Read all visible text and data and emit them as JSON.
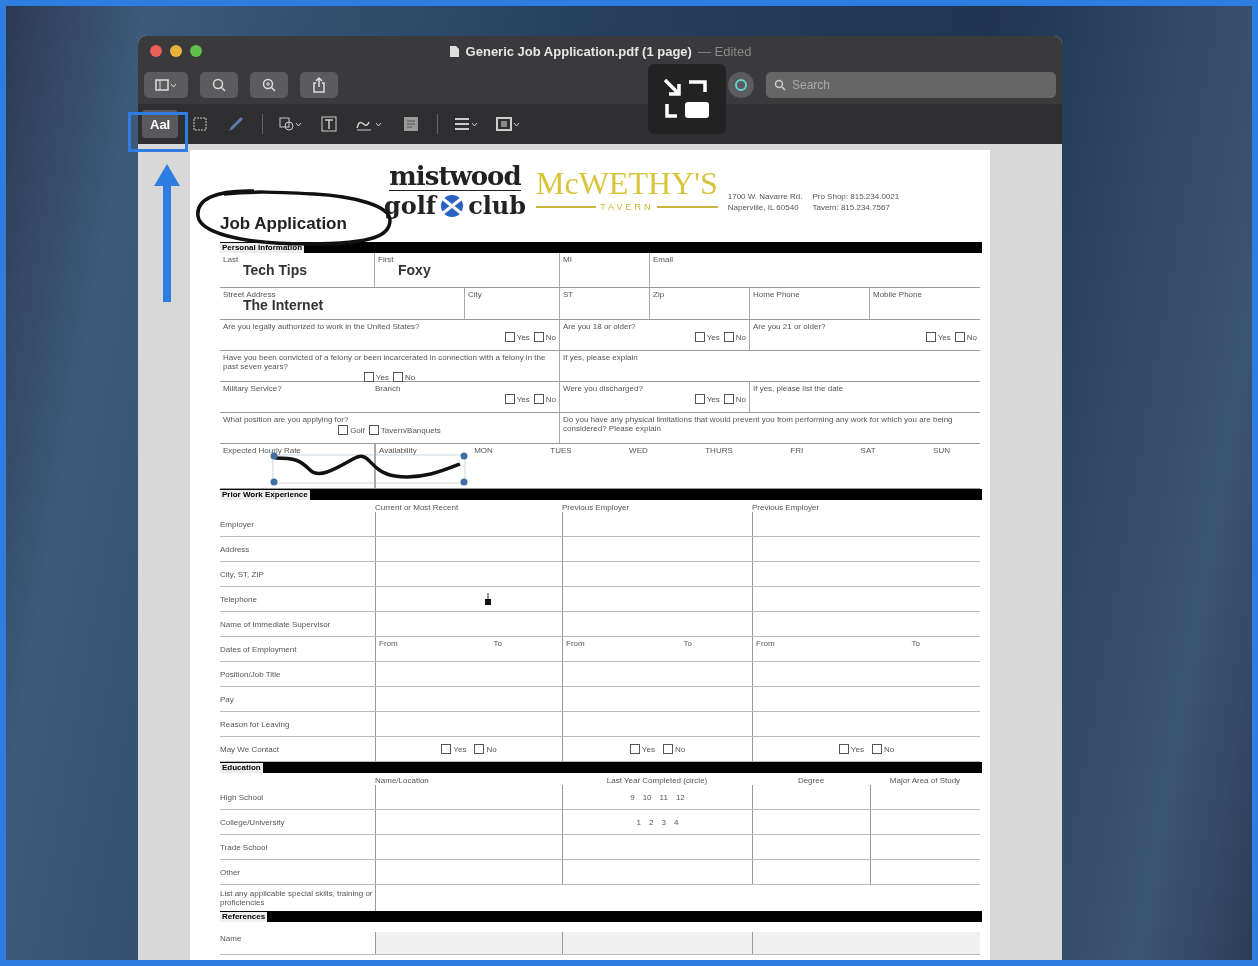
{
  "window": {
    "title": "Generic Job Application.pdf (1 page)",
    "subtitle": "— Edited"
  },
  "search": {
    "placeholder": "Search"
  },
  "markup_toolbar": {
    "text_tool": {
      "label": "AaI",
      "selected": true
    }
  },
  "document": {
    "header": {
      "title": "Job Application",
      "club_logo": {
        "line_1": "mistwood",
        "line_2_left": "golf",
        "line_2_right": "club"
      },
      "tavern_logo": {
        "name": "McWETHY'S",
        "sub": "TAVERN"
      },
      "address": [
        "1700 W. Navarre Rd.",
        "Naperville, IL 60540"
      ],
      "phones": [
        {
          "label": "Pro Shop:",
          "number": "815.234.0021"
        },
        {
          "label": "Tavern:",
          "number": "815.234.7567"
        }
      ]
    },
    "personal": {
      "title": "Personal Information",
      "name_row": [
        {
          "label": "Last",
          "value": "Tech Tips"
        },
        {
          "label": "First",
          "value": "Foxy"
        },
        {
          "label": "MI"
        },
        {
          "label": "Email"
        }
      ],
      "address_row": [
        {
          "label": "Street Address",
          "value": "The Internet"
        },
        {
          "label": "City"
        },
        {
          "label": "ST"
        },
        {
          "label": "Zip"
        },
        {
          "label": "Home Phone"
        },
        {
          "label": "Mobile Phone"
        }
      ],
      "questions": [
        {
          "kind": "three",
          "cells": [
            {
              "text": "Are you legally authorized to work in the United States?",
              "options": [
                {
                  "label": "Yes",
                  "checked": false
                },
                {
                  "label": "No",
                  "checked": false
                }
              ]
            },
            {
              "text": "Are you 18 or older?",
              "options": [
                {
                  "label": "Yes",
                  "checked": false
                },
                {
                  "label": "No",
                  "checked": false
                }
              ]
            },
            {
              "text": "Are you 21 or older?",
              "options": [
                {
                  "label": "Yes",
                  "checked": false
                },
                {
                  "label": "No",
                  "checked": false
                }
              ]
            }
          ]
        },
        {
          "kind": "two",
          "cells": [
            {
              "text": "Have you been convicted of a felony or been incarcerated in connection with a felony in the past seven years?",
              "options": [
                {
                  "label": "Yes",
                  "checked": false
                },
                {
                  "label": "No",
                  "checked": false
                }
              ]
            },
            {
              "text": "If yes, please explain"
            }
          ]
        },
        {
          "kind": "three",
          "cells": [
            {
              "text": "Military Service?",
              "options": [
                {
                  "label": "Yes",
                  "checked": false
                },
                {
                  "label": "No",
                  "checked": false
                }
              ],
              "extra": "Branch"
            },
            {
              "text": "Were you discharged?",
              "options": [
                {
                  "label": "Yes",
                  "checked": false
                },
                {
                  "label": "No",
                  "checked": false
                }
              ]
            },
            {
              "text": "If yes, please list the date"
            }
          ]
        },
        {
          "kind": "two",
          "cells": [
            {
              "text": "What position are you applying for?",
              "options": [
                {
                  "label": "Golf",
                  "checked": false
                },
                {
                  "label": "Tavern/Banquets",
                  "checked": false
                }
              ]
            },
            {
              "text": "Do you have any physical limitations that would prevent you from performing any work for which you are being considered? Please explain"
            }
          ]
        },
        {
          "kind": "availability",
          "cells": [
            {
              "text": "Expected Hourly Rate"
            },
            {
              "text": "Availability",
              "days": [
                "MON",
                "TUES",
                "WED",
                "THURS",
                "FRI",
                "SAT",
                "SUN"
              ]
            }
          ]
        }
      ]
    },
    "work": {
      "title": "Prior Work Experience",
      "columns": [
        "Current or Most Recent",
        "Previous Employer",
        "Previous Employer"
      ],
      "rows": [
        {
          "kind": "blank",
          "label": "Employer"
        },
        {
          "kind": "blank",
          "label": "Address"
        },
        {
          "kind": "blank",
          "label": "City, ST, ZIP"
        },
        {
          "kind": "blank",
          "label": "Telephone"
        },
        {
          "kind": "blank",
          "label": "Name of Immediate Supervisor"
        },
        {
          "kind": "dates",
          "label": "Dates of Employment",
          "cells": [
            {
              "from": "From",
              "to": "To"
            },
            {
              "from": "From",
              "to": "To"
            },
            {
              "from": "From",
              "to": "To"
            }
          ]
        },
        {
          "kind": "blank",
          "label": "Position/Job Title"
        },
        {
          "kind": "blank",
          "label": "Pay"
        },
        {
          "kind": "blank",
          "label": "Reason for Leaving"
        },
        {
          "kind": "contact",
          "label": "May We Contact",
          "cells": [
            {
              "options": [
                {
                  "label": "Yes",
                  "checked": false
                },
                {
                  "label": "No",
                  "checked": false
                }
              ]
            },
            {
              "options": [
                {
                  "label": "Yes",
                  "checked": false
                },
                {
                  "label": "No",
                  "checked": false
                }
              ]
            },
            {
              "options": [
                {
                  "label": "Yes",
                  "checked": false
                },
                {
                  "label": "No",
                  "checked": false
                }
              ]
            }
          ]
        }
      ]
    },
    "education": {
      "title": "Education",
      "columns": [
        "Name/Location",
        "Last Year Completed (circle)",
        "Degree",
        "Major Area of Study"
      ],
      "rows": [
        {
          "label": "High School",
          "years": [
            "9",
            "10",
            "11",
            "12"
          ]
        },
        {
          "label": "College/University",
          "years": [
            "1",
            "2",
            "3",
            "4"
          ]
        },
        {
          "label": "Trade School"
        },
        {
          "label": "Other"
        }
      ],
      "skills_label": "List any applicable special skills, training or proficiencies"
    },
    "references": {
      "title": "References",
      "rows": [
        {
          "label": "Name"
        }
      ]
    }
  }
}
